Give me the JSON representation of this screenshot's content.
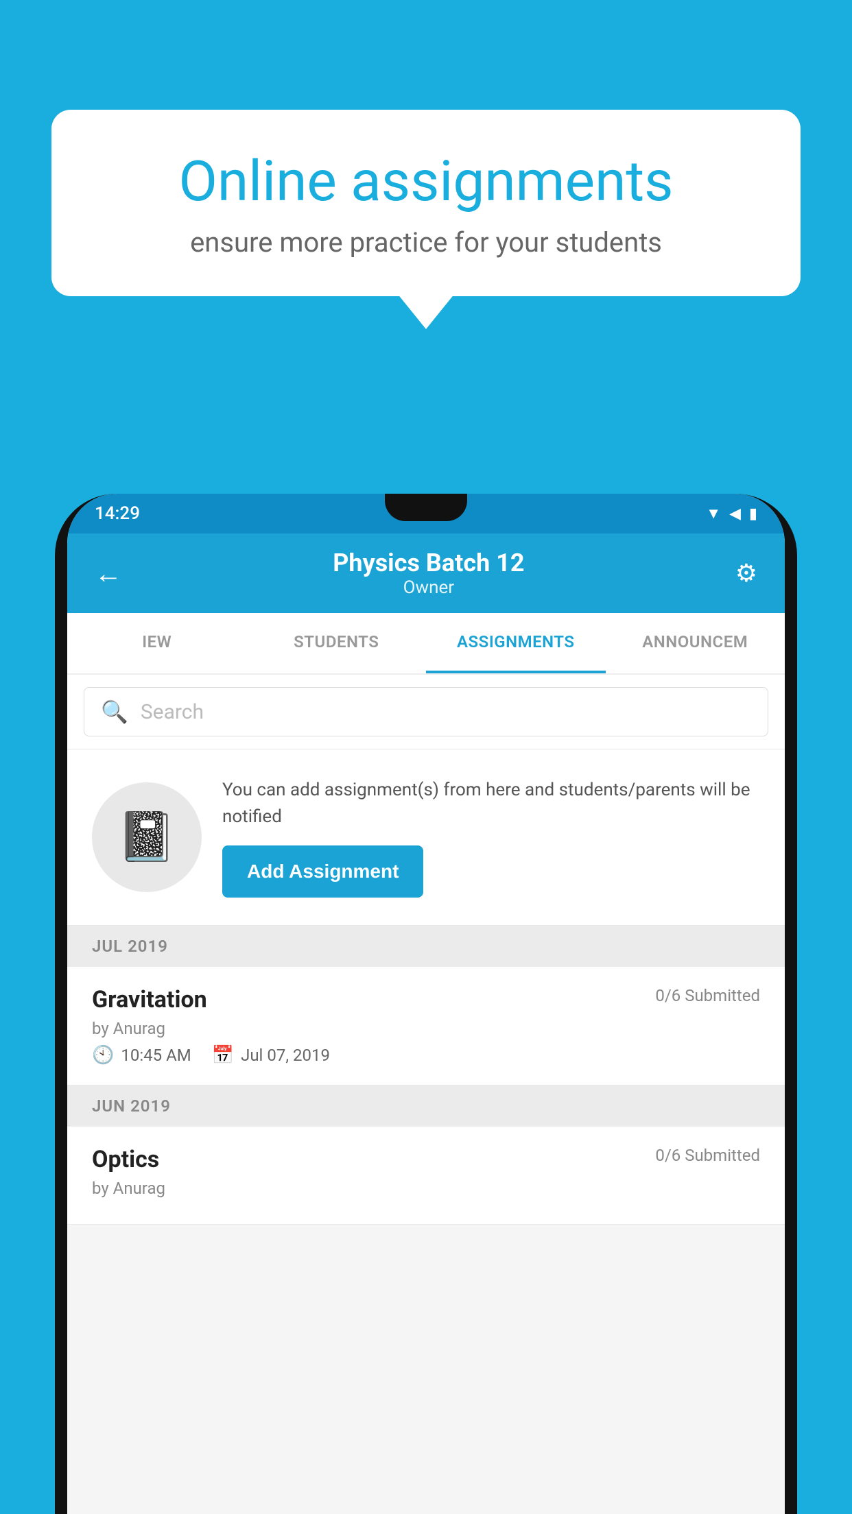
{
  "background": {
    "color": "#19AEDE"
  },
  "speech_bubble": {
    "title": "Online assignments",
    "subtitle": "ensure more practice for your students"
  },
  "phone": {
    "status_bar": {
      "time": "14:29",
      "icons": "▼◀▮"
    },
    "header": {
      "title": "Physics Batch 12",
      "subtitle": "Owner",
      "back_icon": "←",
      "settings_icon": "⚙"
    },
    "tabs": [
      {
        "label": "IEW",
        "active": false
      },
      {
        "label": "STUDENTS",
        "active": false
      },
      {
        "label": "ASSIGNMENTS",
        "active": true
      },
      {
        "label": "ANNOUNCEM",
        "active": false
      }
    ],
    "search": {
      "placeholder": "Search"
    },
    "promo": {
      "text": "You can add assignment(s) from here and students/parents will be notified",
      "button_label": "Add Assignment"
    },
    "assignments": [
      {
        "month_label": "JUL 2019",
        "title": "Gravitation",
        "by": "by Anurag",
        "submitted": "0/6 Submitted",
        "time": "10:45 AM",
        "date": "Jul 07, 2019"
      },
      {
        "month_label": "JUN 2019",
        "title": "Optics",
        "by": "by Anurag",
        "submitted": "0/6 Submitted",
        "time": "",
        "date": ""
      }
    ]
  }
}
